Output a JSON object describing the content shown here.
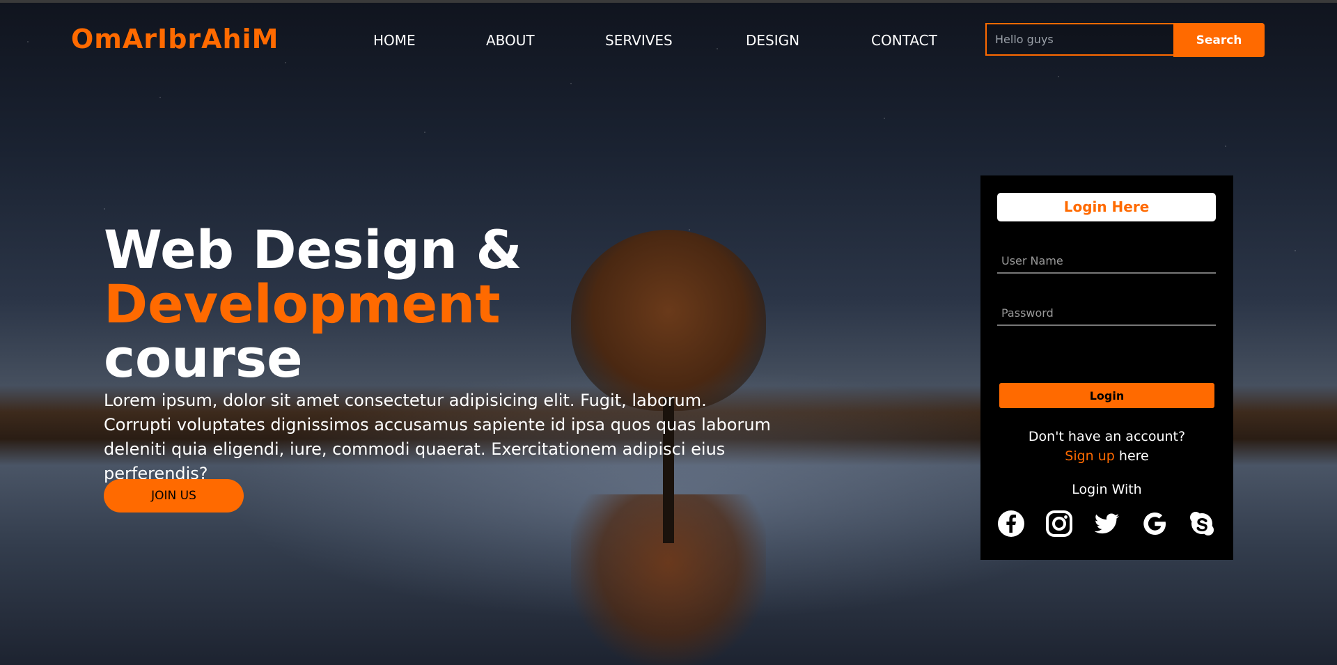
{
  "brand": {
    "logo": "OmArIbrAhiM",
    "accent_color": "#ff6a00"
  },
  "nav": {
    "items": [
      "HOME",
      "ABOUT",
      "SERVIVES",
      "DESIGN",
      "CONTACT"
    ]
  },
  "search": {
    "placeholder": "Hello guys",
    "value": "",
    "button_label": "Search"
  },
  "hero": {
    "line1": "Web Design &",
    "line2": "Development",
    "line3": "course",
    "paragraph": "Lorem ipsum, dolor sit amet consectetur adipisicing elit. Fugit, laborum. Corrupti voluptates dignissimos accusamus sapiente id ipsa quos quas laborum deleniti quia eligendi, iure, commodi quaerat. Exercitationem adipisci eius perferendis?",
    "cta_label": "JOIN US"
  },
  "login": {
    "title": "Login Here",
    "username_placeholder": "User Name",
    "password_placeholder": "Password",
    "button_label": "Login",
    "no_account_text": "Don't have an account?",
    "signup_link": "Sign up",
    "signup_suffix": " here",
    "login_with": "Login With",
    "socials": [
      "facebook-icon",
      "instagram-icon",
      "twitter-icon",
      "google-icon",
      "skype-icon"
    ]
  }
}
